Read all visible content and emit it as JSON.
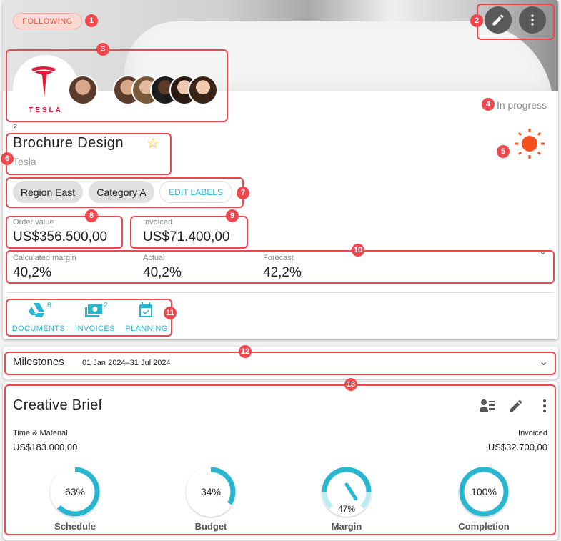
{
  "header": {
    "following_label": "FOLLOWING",
    "edit_icon": "pencil-icon",
    "more_icon": "more-vert-icon",
    "status": "In progress",
    "status_icon": "sun-icon",
    "status_color": "#f4511e"
  },
  "client": {
    "logo_text": "TESLA",
    "brand_color": "#e31937"
  },
  "project": {
    "number": "2",
    "title": "Brochure Design",
    "client": "Tesla",
    "favorite_icon": "star-outline-icon"
  },
  "labels": {
    "items": [
      "Region East",
      "Category A"
    ],
    "edit_label": "EDIT LABELS"
  },
  "financials": {
    "order_value_label": "Order value",
    "order_value": "US$356.500,00",
    "invoiced_label": "Invoiced",
    "invoiced": "US$71.400,00",
    "margin_label": "Calculated margin",
    "margin": "40,2%",
    "actual_label": "Actual",
    "actual": "40,2%",
    "forecast_label": "Forecast",
    "forecast": "42,2%"
  },
  "tabs": [
    {
      "label": "DOCUMENTS",
      "count": "8",
      "icon": "drive-icon"
    },
    {
      "label": "INVOICES",
      "count": "2",
      "icon": "money-icon"
    },
    {
      "label": "PLANNING",
      "count": "",
      "icon": "calendar-check-icon"
    }
  ],
  "milestones": {
    "label": "Milestones",
    "dates": "01 Jan 2024–31 Jul 2024"
  },
  "phase": {
    "title": "Creative Brief",
    "type_label": "Time & Material",
    "type_value": "US$183.000,00",
    "invoiced_label": "Invoiced",
    "invoiced_value": "US$32.700,00",
    "gauges": [
      {
        "label": "Schedule",
        "value": 63,
        "text": "63%"
      },
      {
        "label": "Budget",
        "value": 34,
        "text": "34%"
      },
      {
        "label": "Margin",
        "value": 47,
        "text": "47%"
      },
      {
        "label": "Completion",
        "value": 100,
        "text": "100%"
      }
    ]
  },
  "accent_color": "#29b6d1",
  "annotations": [
    "1",
    "2",
    "3",
    "4",
    "5",
    "6",
    "7",
    "8",
    "9",
    "10",
    "11",
    "12",
    "13"
  ]
}
